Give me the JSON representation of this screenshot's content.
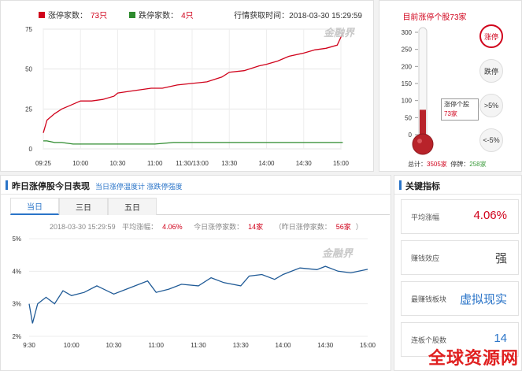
{
  "top_panel": {
    "legend": {
      "up_label": "涨停家数：",
      "up_value": "73只",
      "down_label": "跌停家数：",
      "down_value": "4只"
    },
    "update_label": "行情获取时间：",
    "update_time": "2018-03-30  15:29:59",
    "watermark": "金融界"
  },
  "thermometer": {
    "title": "目前涨停个股73家",
    "scale": [
      "300",
      "250",
      "200",
      "150",
      "100",
      "50",
      "0"
    ],
    "callout_label": "涨停个股",
    "callout_value": "73家",
    "buttons": [
      "涨停",
      "跌停",
      ">5%",
      "<-5%"
    ],
    "total_label": "总计：",
    "total_value": "3505家",
    "halt_label": "停牌：",
    "halt_value": "258家"
  },
  "bottom_panel": {
    "section_title": "昨日涨停股今日表现",
    "links": "当日涨停温度计  涨跌停强度",
    "tabs": [
      "当日",
      "三日",
      "五日"
    ],
    "info_time": "2018-03-30  15:29:59",
    "avg_label": "平均涨幅：",
    "avg_value": "4.06%",
    "today_up_label": "今日涨停家数：",
    "today_up_value": "14家",
    "yesterday_label": "（昨日涨停家数：",
    "yesterday_value": "56家",
    "yesterday_close": "）",
    "watermark": "金融界"
  },
  "indicators": {
    "title": "关键指标",
    "cards": [
      {
        "label": "平均涨幅",
        "value": "4.06%"
      },
      {
        "label": "赚钱效应",
        "value": "强"
      },
      {
        "label": "最赚钱板块",
        "value": "虚拟现实"
      },
      {
        "label": "连板个股数",
        "value": "14"
      }
    ]
  },
  "footer_brand": "全球资源网",
  "colors": {
    "up": "#d0021b",
    "down": "#2e8b2e",
    "line": "#1f5a96",
    "accent": "#2a74c8"
  },
  "chart_data": [
    {
      "type": "line",
      "title": "",
      "x_ticks": [
        "09:25",
        "10:00",
        "10:30",
        "11:00",
        "11:30/13:00",
        "13:30",
        "14:00",
        "14:30",
        "15:00"
      ],
      "y_ticks": [
        0,
        25,
        50,
        75
      ],
      "ylim": [
        0,
        75
      ],
      "series": [
        {
          "name": "涨停家数",
          "color": "#d0021b",
          "x": [
            0,
            0.1,
            0.3,
            0.5,
            0.7,
            0.9,
            1.0,
            1.3,
            1.6,
            1.9,
            2.0,
            2.3,
            2.6,
            2.9,
            3.2,
            3.6,
            4.0,
            4.4,
            4.8,
            5.0,
            5.4,
            5.8,
            6.0,
            6.3,
            6.6,
            7.0,
            7.3,
            7.6,
            7.9,
            8.0,
            8.05
          ],
          "y": [
            10,
            18,
            22,
            25,
            27,
            29,
            30,
            30,
            31,
            33,
            35,
            36,
            37,
            38,
            38,
            40,
            41,
            42,
            45,
            48,
            49,
            52,
            53,
            55,
            58,
            60,
            62,
            63,
            65,
            70,
            73
          ]
        },
        {
          "name": "跌停家数",
          "color": "#2e8b2e",
          "x": [
            0,
            0.1,
            0.3,
            0.5,
            0.8,
            1.0,
            1.3,
            1.6,
            2.0,
            2.5,
            3.0,
            3.5,
            4.0,
            4.5,
            5.0,
            5.5,
            6.0,
            6.5,
            7.0,
            7.5,
            8.05
          ],
          "y": [
            5,
            5,
            4,
            4,
            3,
            3,
            3,
            3,
            3,
            3,
            3,
            4,
            4,
            4,
            4,
            4,
            4,
            4,
            4,
            4,
            4
          ]
        }
      ]
    },
    {
      "type": "line",
      "title": "",
      "x_ticks": [
        "9:30",
        "10:00",
        "10:30",
        "11:00",
        "11:30",
        "13:30",
        "14:00",
        "14:30",
        "15:00"
      ],
      "y_ticks": [
        "2%",
        "3%",
        "4%",
        "5%"
      ],
      "ylim": [
        2,
        5
      ],
      "series": [
        {
          "name": "平均涨幅",
          "color": "#1f5a96",
          "x": [
            0,
            0.08,
            0.2,
            0.4,
            0.6,
            0.8,
            1.0,
            1.3,
            1.6,
            2.0,
            2.4,
            2.8,
            3.0,
            3.3,
            3.6,
            4.0,
            4.3,
            4.6,
            5.0,
            5.2,
            5.5,
            5.8,
            6.0,
            6.4,
            6.8,
            7.0,
            7.3,
            7.6,
            8.0
          ],
          "y": [
            3.0,
            2.4,
            3.0,
            3.2,
            3.0,
            3.4,
            3.25,
            3.35,
            3.55,
            3.3,
            3.5,
            3.7,
            3.35,
            3.45,
            3.6,
            3.55,
            3.8,
            3.65,
            3.55,
            3.85,
            3.9,
            3.75,
            3.9,
            4.1,
            4.05,
            4.15,
            4.0,
            3.95,
            4.06
          ]
        }
      ]
    }
  ]
}
